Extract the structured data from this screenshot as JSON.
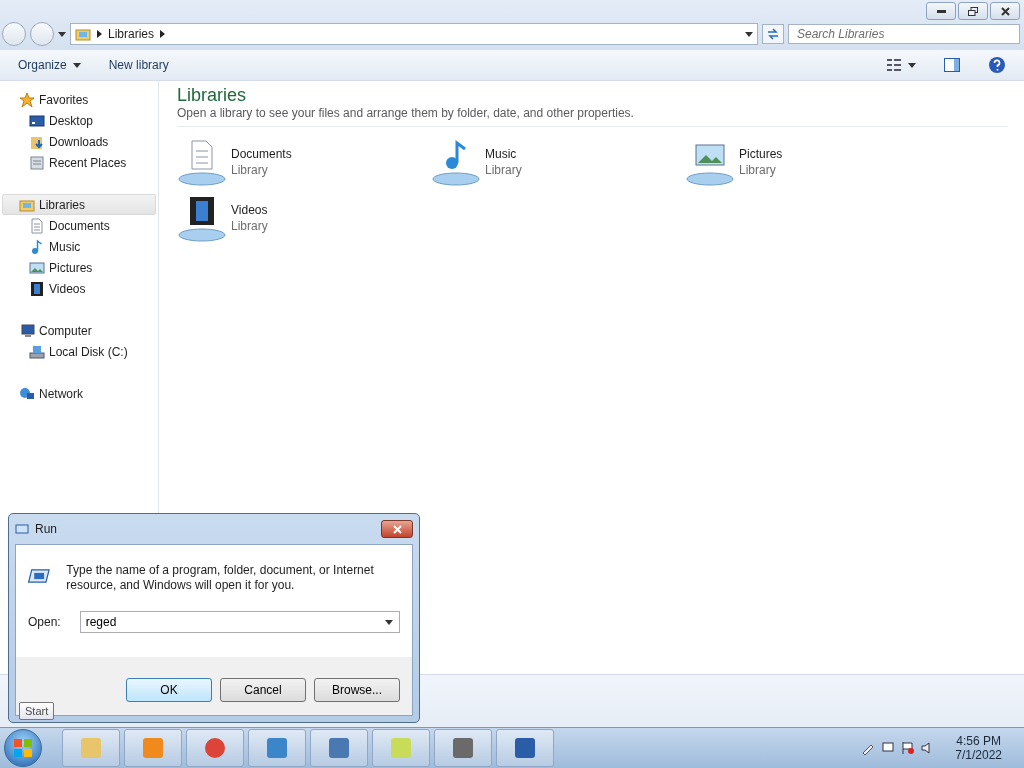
{
  "address_bar": {
    "crumbs": [
      "Libraries"
    ]
  },
  "search": {
    "placeholder": "Search Libraries"
  },
  "toolbar": {
    "buttons": [
      {
        "label": "Organize",
        "dropdown": true
      },
      {
        "label": "New library",
        "dropdown": false
      }
    ]
  },
  "sidebar": {
    "groups": [
      {
        "label": "Favorites",
        "kind": "star",
        "selected": false,
        "children": [
          {
            "label": "Desktop",
            "kind": "desktop",
            "selected": false
          },
          {
            "label": "Downloads",
            "kind": "downloads",
            "selected": false
          },
          {
            "label": "Recent Places",
            "kind": "recent",
            "selected": false
          }
        ]
      },
      {
        "label": "Libraries",
        "kind": "library",
        "selected": true,
        "children": [
          {
            "label": "Documents",
            "kind": "document",
            "selected": false
          },
          {
            "label": "Music",
            "kind": "music",
            "selected": false
          },
          {
            "label": "Pictures",
            "kind": "picture",
            "selected": false
          },
          {
            "label": "Videos",
            "kind": "video",
            "selected": false
          }
        ]
      },
      {
        "label": "Computer",
        "kind": "computer",
        "selected": false,
        "children": [
          {
            "label": "Local Disk (C:)",
            "kind": "disk",
            "selected": false
          }
        ]
      },
      {
        "label": "Network",
        "kind": "network",
        "selected": false
      }
    ]
  },
  "content": {
    "title": "Libraries",
    "subtitle": "Open a library to see your files and arrange them by folder, date, and other properties.",
    "libraries": [
      {
        "name": "Documents",
        "type": "Library",
        "kind": "document"
      },
      {
        "name": "Music",
        "type": "Library",
        "kind": "music"
      },
      {
        "name": "Pictures",
        "type": "Library",
        "kind": "picture"
      },
      {
        "name": "Videos",
        "type": "Library",
        "kind": "video"
      }
    ]
  },
  "run_dialog": {
    "title": "Run",
    "message": "Type the name of a program, folder, document, or Internet resource, and Windows will open it for you.",
    "open_label": "Open:",
    "value": "reged",
    "buttons": [
      {
        "label": "OK",
        "default": true
      },
      {
        "label": "Cancel",
        "default": false
      },
      {
        "label": "Browse...",
        "default": false
      }
    ]
  },
  "tooltip": {
    "text": "Start"
  },
  "taskbar": {
    "time": "4:56 PM",
    "date": "7/1/2022"
  }
}
